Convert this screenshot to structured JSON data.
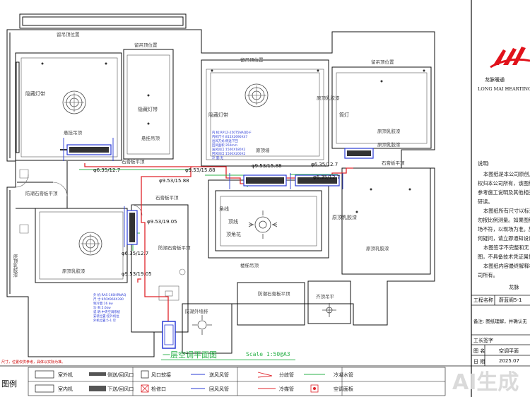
{
  "company": {
    "logo_text": "LMHC",
    "name_cn": "龙脉暖通",
    "name_en": "LONG MAI HEARTING C",
    "footer_name": "龙脉"
  },
  "notes": {
    "title": "说明:",
    "lines": [
      "本图纸是本公司原创,",
      "权归本公司所有，该图纸",
      "参考施工说明及其他相关",
      "研读。",
      "本图纸所有尺寸以标注",
      "勿按比例测量。如果图纸",
      "场不符，以现场为准。施",
      "何疑问，请立即通知设计",
      "本图签字不完整和无",
      "图，不具备技术凭证属性",
      "本图纸内容最终解释权",
      "司所有。"
    ]
  },
  "title_block": {
    "project_label": "工程名称",
    "project_value": "蔚蓝阁5-1",
    "remark_label": "备注",
    "remark_value": "备注: 图纸理解，并确认无",
    "signature_label": "工长签字",
    "drawing_label": "图    名",
    "drawing_value": "空调平面",
    "date_label": "日    期",
    "date_value": "2025.07"
  },
  "plan": {
    "title": "一层空调平面图",
    "scale": "Scale 1:50@A3",
    "rooms": {
      "balcony": "留吊顶位置",
      "cabinet_top": "留吊顶位置",
      "dining_top": "留吊顶位置",
      "living_top": "留吊顶位置",
      "entry_left": "隐藏灯带",
      "entry_right": "隐藏灯带",
      "dining_left": "隐藏灯带",
      "corner_light": "隐藏灯带",
      "bedroom_light": "隐藏灯带",
      "light_strip_c": "筒灯",
      "ceiling_left": "悬挂吊顶",
      "ceiling_mid": "悬挂吊顶",
      "gypsum_flat1": "石膏板平顶",
      "gypsum_flat2": "石膏板平顶",
      "gypsum_flat3": "石膏板平顶",
      "gypsum_flat4": "防潮石膏板平顶",
      "gypsum_flat5": "防潮石膏板平顶",
      "paint_1": "原顶乳胶漆",
      "paint_2": "原顶乳胶漆",
      "paint_3": "原顶乳胶漆",
      "paint_4": "原顶乳胶漆",
      "paint_5": "原顶乳胶漆",
      "paint_6": "原顶乳胶漆",
      "bay": "原顶乳胶漆",
      "ceiling_inner": "原顶墙",
      "corner_line": "角线",
      "top_line": "顶线",
      "flower": "顶角花",
      "wood": "木饰线",
      "side_ceiling": "防潮石膏板平顶",
      "wash_room": "防潮外墙排",
      "far_right": "齐顶吊平",
      "stair": "楼梯吊顶"
    },
    "pipes": {
      "p1": "φ6.35/12.7",
      "p2": "φ9.53/15.88",
      "p3": "φ9.53/15.88",
      "p4": "φ9.53/15.88",
      "p5": "φ6.35/12.7",
      "p6": "φ6.35/12.7",
      "p7": "φ9.53/19.05",
      "p8": "φ6.35/12.7",
      "p9": "φ9.53/19.05"
    },
    "spec_block": {
      "lines": [
        "内    机:RP1Z-250T5NAQD-F",
        "内机尺寸:815X2690X47",
        "出风方式:侧送下回",
        "回风面积:350mm",
        "送风风口:1500X180X2",
        "回风风口:1500X200X2",
        "冷  量:无"
      ]
    },
    "outdoor_block": {
      "lines": [
        "外    机:RAS-160HRNAQ",
        "尺    寸:950X960X390",
        "制冷量:16 kw",
        "功    率:5.6kw",
        "说    明:中央空调系统",
        "安装位置:室外机位",
        "外机位置:5-1 空"
      ]
    }
  },
  "legend": {
    "title": "图例",
    "left_note": "尺寸，位置仅供参考，具体以实际为准。",
    "items": [
      {
        "label": "室外机"
      },
      {
        "label": "室内机"
      },
      {
        "label": "侧送/回风口"
      },
      {
        "label": "下送/回风口"
      },
      {
        "label": "风口软接"
      },
      {
        "label": "检修口"
      },
      {
        "label": "送风风管"
      },
      {
        "label": "回风风管"
      },
      {
        "label": "分歧管"
      },
      {
        "label": "冷媒管"
      },
      {
        "label": "冷凝水管"
      },
      {
        "label": "空调面板"
      }
    ]
  },
  "watermark": "AI生成",
  "colors": {
    "wall": "#111111",
    "blue_label": "#2a3bd6",
    "pipe_red": "#e0242a",
    "pipe_green": "#2bb24a",
    "logo_red": "#e1121b"
  }
}
